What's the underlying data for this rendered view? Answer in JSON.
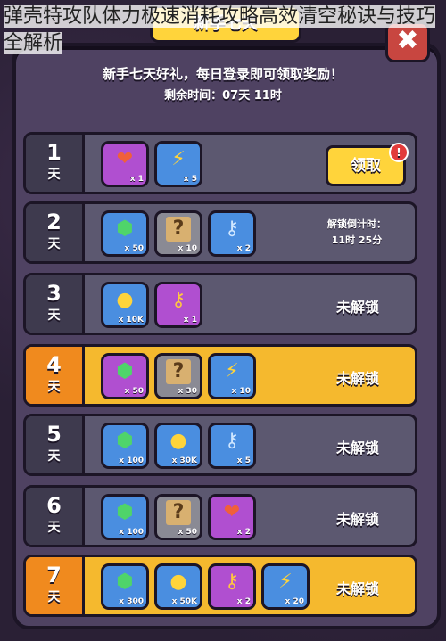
{
  "caption": "弹壳特攻队体力极速消耗攻略高效清空秘诀与技巧全解析",
  "panel": {
    "title": "新手七天",
    "close_label": "✖",
    "promo_main": "新手七天好礼，每日登录即可领取奖励！",
    "promo_sub": "剩余时间：07天 11时"
  },
  "days": [
    {
      "num": "1",
      "unit": "天",
      "status": "领取",
      "claimable": true,
      "rewards": [
        {
          "icon": "heart-icon",
          "glyph": "❤",
          "qty": "x 1",
          "bg": "purple"
        },
        {
          "icon": "lightning-icon",
          "glyph": "⚡",
          "qty": "x 5",
          "bg": "blue"
        }
      ]
    },
    {
      "num": "2",
      "unit": "天",
      "countdown_label": "解锁倒计时：",
      "countdown_value": "11时 25分",
      "rewards": [
        {
          "icon": "gem-icon",
          "glyph": "⬢",
          "qty": "x 50",
          "bg": "blue"
        },
        {
          "icon": "scroll-icon",
          "glyph": "?",
          "qty": "x 10",
          "bg": "gray"
        },
        {
          "icon": "key-icon",
          "glyph": "⚷",
          "qty": "x 2",
          "bg": "blue"
        }
      ]
    },
    {
      "num": "3",
      "unit": "天",
      "status": "未解锁",
      "rewards": [
        {
          "icon": "coin-icon",
          "glyph": "●",
          "qty": "x 10K",
          "bg": "blue"
        },
        {
          "icon": "key-icon",
          "glyph": "⚷",
          "qty": "x 1",
          "bg": "purple"
        }
      ]
    },
    {
      "num": "4",
      "unit": "天",
      "status": "未解锁",
      "gold": true,
      "rewards": [
        {
          "icon": "gem-icon",
          "glyph": "⬢",
          "qty": "x 50",
          "bg": "purple"
        },
        {
          "icon": "scroll-icon",
          "glyph": "?",
          "qty": "x 30",
          "bg": "gray"
        },
        {
          "icon": "lightning-icon",
          "glyph": "⚡",
          "qty": "x 10",
          "bg": "blue"
        }
      ]
    },
    {
      "num": "5",
      "unit": "天",
      "status": "未解锁",
      "rewards": [
        {
          "icon": "gem-icon",
          "glyph": "⬢",
          "qty": "x 100",
          "bg": "blue"
        },
        {
          "icon": "coin-icon",
          "glyph": "●",
          "qty": "x 30K",
          "bg": "blue"
        },
        {
          "icon": "key-icon",
          "glyph": "⚷",
          "qty": "x 5",
          "bg": "blue"
        }
      ]
    },
    {
      "num": "6",
      "unit": "天",
      "status": "未解锁",
      "rewards": [
        {
          "icon": "gem-icon",
          "glyph": "⬢",
          "qty": "x 100",
          "bg": "blue"
        },
        {
          "icon": "scroll-icon",
          "glyph": "?",
          "qty": "x 50",
          "bg": "gray"
        },
        {
          "icon": "heart-icon",
          "glyph": "❤",
          "qty": "x 2",
          "bg": "purple"
        }
      ]
    },
    {
      "num": "7",
      "unit": "天",
      "status": "未解锁",
      "gold": true,
      "rewards": [
        {
          "icon": "gem-icon",
          "glyph": "⬢",
          "qty": "x 300",
          "bg": "blue"
        },
        {
          "icon": "coin-icon",
          "glyph": "●",
          "qty": "x 50K",
          "bg": "blue"
        },
        {
          "icon": "key-icon",
          "glyph": "⚷",
          "qty": "x 2",
          "bg": "purple"
        },
        {
          "icon": "lightning-icon",
          "glyph": "⚡",
          "qty": "x 20",
          "bg": "blue"
        }
      ]
    }
  ],
  "colors": {
    "gem": "#4fd46a",
    "heart": "#f0603a",
    "lightning": "#ffd43b",
    "coin": "#ffd43b",
    "key_blue": "#cfe6ff",
    "key_gold": "#ffc640",
    "scroll": "#d8b070"
  }
}
